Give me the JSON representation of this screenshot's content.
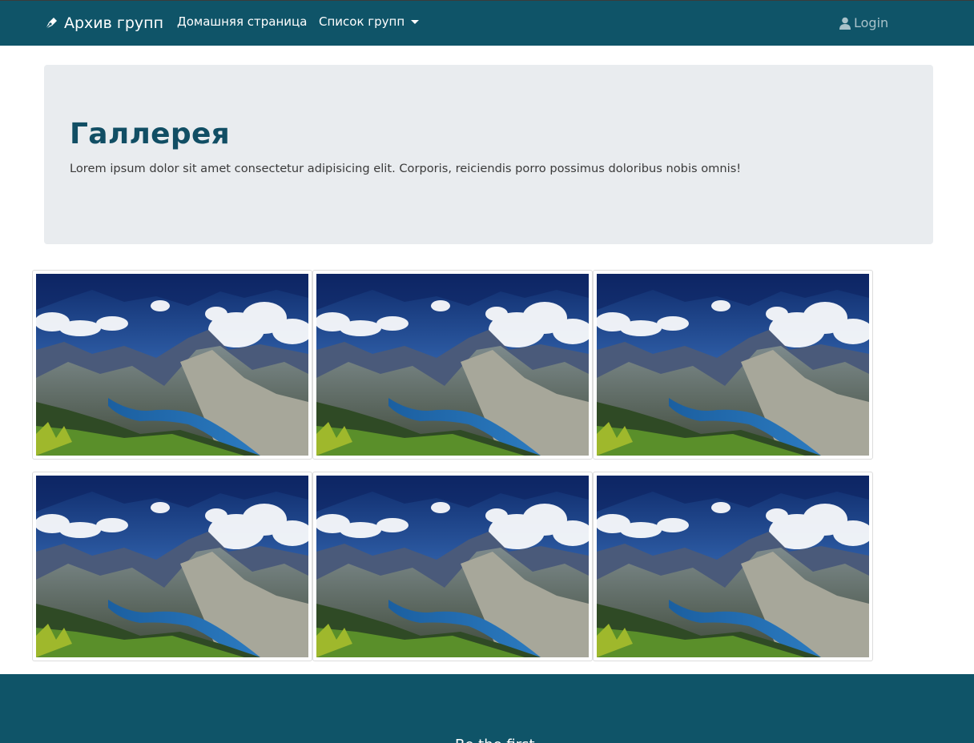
{
  "navbar": {
    "brand": "Архив групп",
    "brand_icon": "pen-nib-icon",
    "links": [
      {
        "label": "Домашняя страница"
      },
      {
        "label": "Список групп",
        "has_dropdown": true
      }
    ],
    "login": "Login",
    "login_icon": "user-icon"
  },
  "jumbotron": {
    "title": "Галлерея",
    "lead": "Lorem ipsum dolor sit amet consectetur adipisicing elit. Corporis, reiciendis porro possimus doloribus nobis omnis!"
  },
  "gallery": {
    "image_count": 6,
    "image_subject": "mountain-lake-landscape"
  },
  "footer": {
    "text": "Be the first..."
  },
  "colors": {
    "primary": "#0f5468",
    "title": "#114e64",
    "jumbotron_bg": "#e9ecef",
    "login": "#a9c2ca"
  }
}
